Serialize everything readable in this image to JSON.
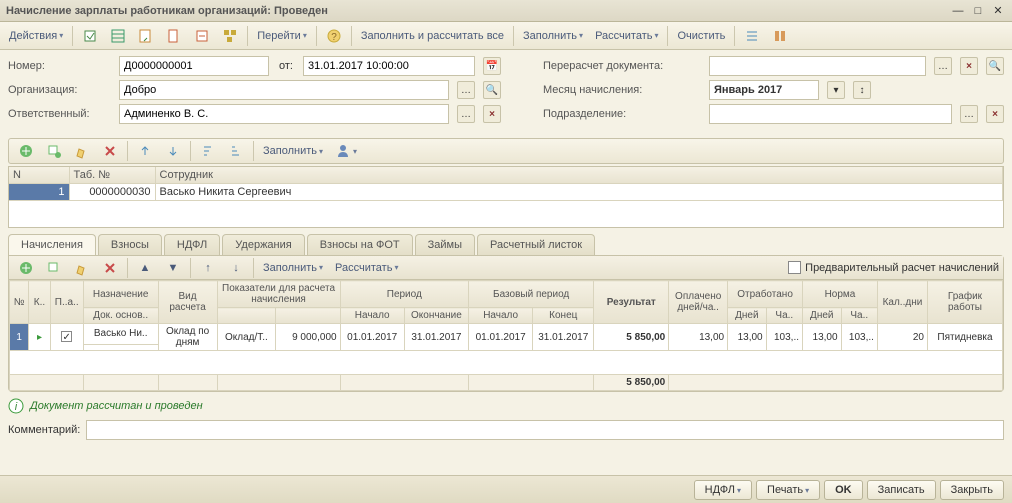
{
  "window": {
    "title": "Начисление зарплаты работникам организаций: Проведен"
  },
  "toolbar": {
    "actions": "Действия",
    "goto": "Перейти",
    "fill_calc_all": "Заполнить и рассчитать все",
    "fill": "Заполнить",
    "calculate": "Рассчитать",
    "clear": "Очистить"
  },
  "header": {
    "number_label": "Номер:",
    "number": "Д0000000001",
    "from_label": "от:",
    "date": "31.01.2017 10:00:00",
    "org_label": "Организация:",
    "org": "Добро",
    "resp_label": "Ответственный:",
    "resp": "Админенко В. С.",
    "recalc_label": "Перерасчет документа:",
    "recalc": "",
    "month_label": "Месяц начисления:",
    "month": "Январь 2017",
    "dept_label": "Подразделение:",
    "dept": ""
  },
  "subtoolbar": {
    "fill": "Заполнить"
  },
  "table1": {
    "headers": {
      "n": "N",
      "tab": "Таб. №",
      "emp": "Сотрудник"
    },
    "rows": [
      {
        "n": "1",
        "tab": "0000000030",
        "emp": "Васько Никита Сергеевич"
      }
    ]
  },
  "tabs": [
    "Начисления",
    "Взносы",
    "НДФЛ",
    "Удержания",
    "Взносы на ФОТ",
    "Займы",
    "Расчетный листок"
  ],
  "innerbar": {
    "fill": "Заполнить",
    "calc": "Рассчитать",
    "preview": "Предварительный расчет начислений"
  },
  "grid": {
    "headers": {
      "n": "№",
      "k": "К..",
      "p": "П..а..",
      "naz": "Назначение",
      "dokosn": "Док. основ..",
      "vid": "Вид расчета",
      "pokaz": "Показатели для расчета начисления",
      "period": "Период",
      "nachalo": "Начало",
      "okonch": "Окончание",
      "bperiod": "Базовый период",
      "bn": "Начало",
      "bk": "Конец",
      "result": "Результат",
      "oplach": "Оплачено дней/ча..",
      "otrab": "Отработано",
      "odnej": "Дней",
      "ocha": "Ча..",
      "norma": "Норма",
      "ndnej": "Дней",
      "ncha": "Ча..",
      "kal": "Кал..дни",
      "grafik": "График работы"
    },
    "row": {
      "n": "1",
      "p_checked": true,
      "naz": "Васько Ни..",
      "vid": "Оклад по дням",
      "pokaz1": "Оклад/Т..",
      "pokaz2": "9 000,000",
      "nachalo": "01.01.2017",
      "okonch": "31.01.2017",
      "bn": "01.01.2017",
      "bk": "31.01.2017",
      "result": "5 850,00",
      "oplach": "13,00",
      "odnej": "13,00",
      "ocha": "103,..",
      "ndnej": "13,00",
      "ncha": "103,..",
      "kal": "20",
      "grafik": "Пятидневка"
    },
    "total": "5 850,00"
  },
  "status": "Документ рассчитан и проведен",
  "comment": {
    "label": "Комментарий:",
    "value": ""
  },
  "footer": {
    "ndfl": "НДФЛ",
    "print": "Печать",
    "ok": "OK",
    "save": "Записать",
    "close": "Закрыть"
  }
}
